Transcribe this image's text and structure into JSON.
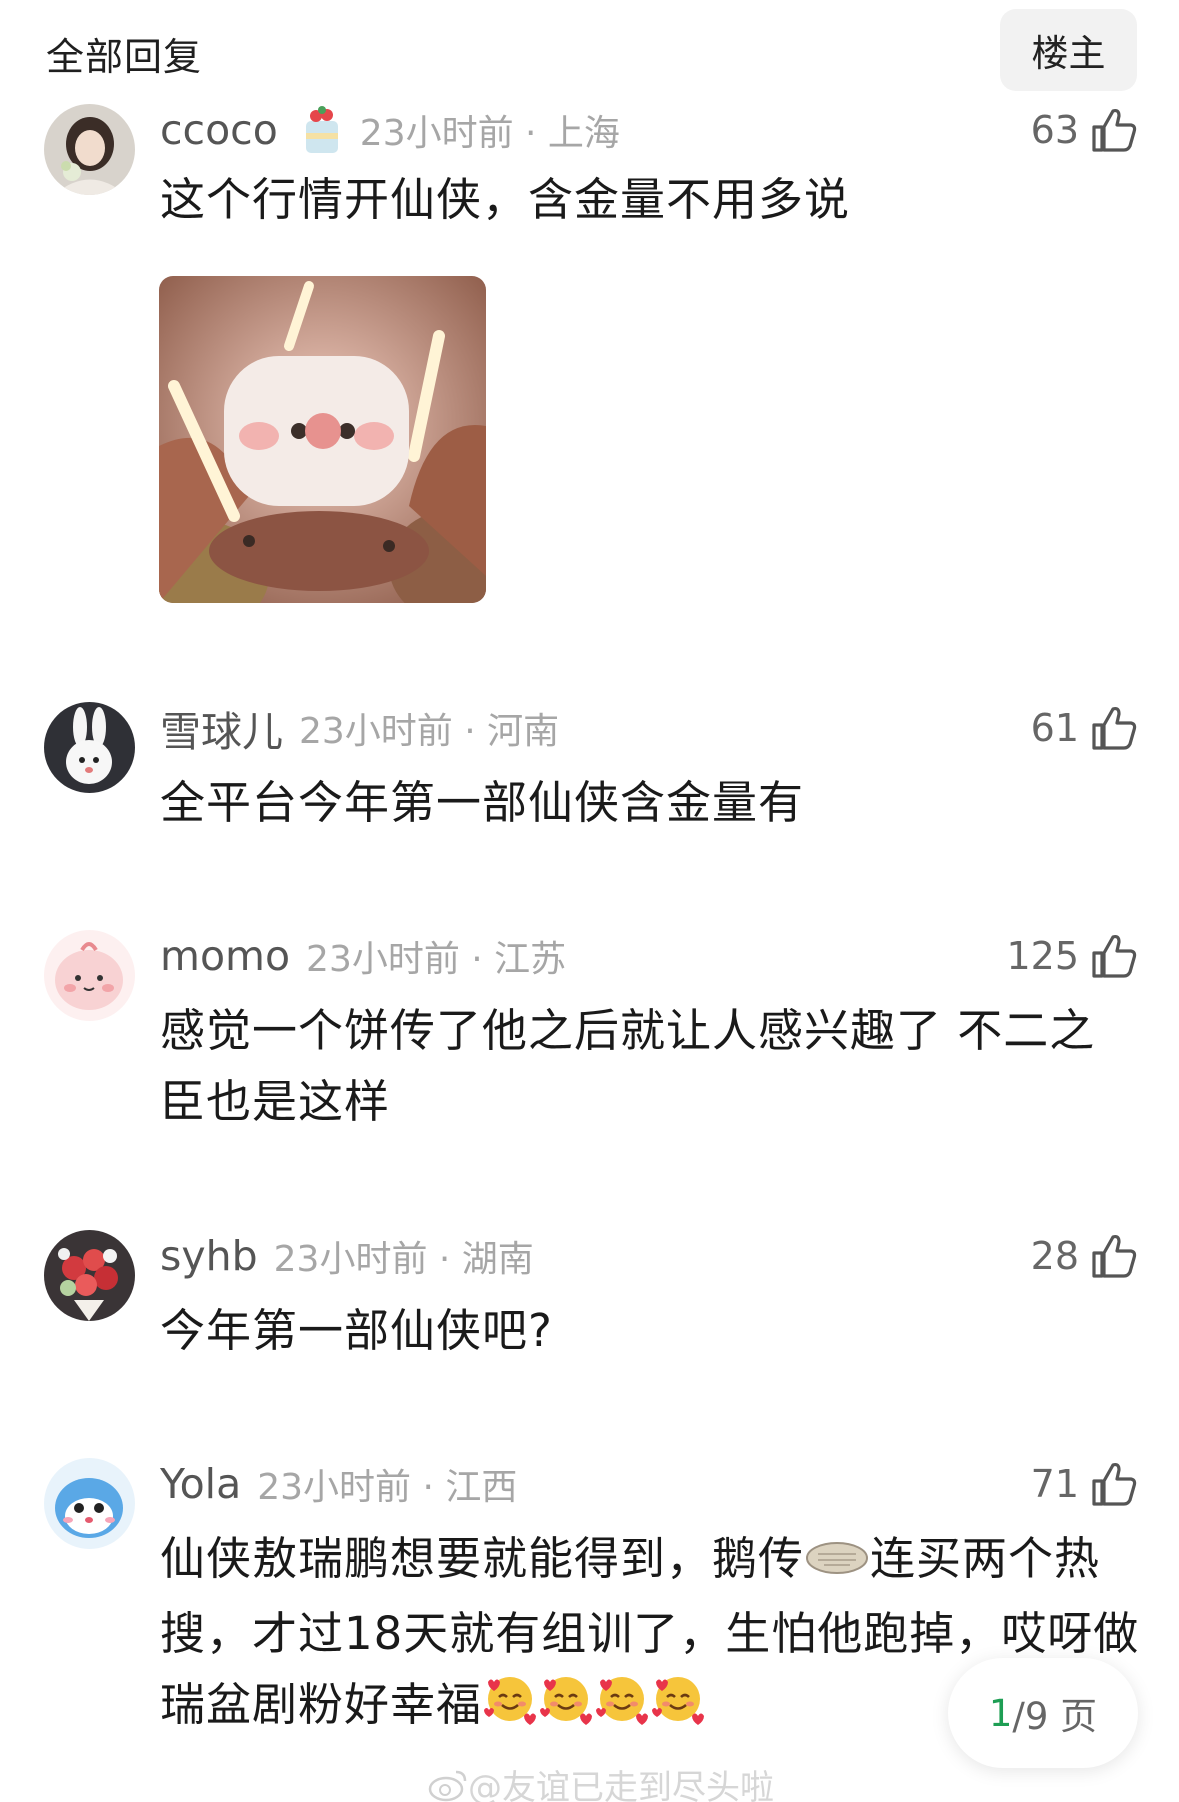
{
  "header": {
    "title": "全部回复",
    "filter_label": "楼主"
  },
  "comments": [
    {
      "username": "ccoco",
      "meta": "23小时前 · 上海",
      "likes": "63",
      "text": "这个行情开仙侠，含金量不用多说",
      "has_image": true,
      "avatar": "girl-avatar",
      "badge": "cake-badge-icon"
    },
    {
      "username": "雪球儿",
      "meta": "23小时前 · 河南",
      "likes": "61",
      "text": "全平台今年第一部仙侠含金量有",
      "avatar": "bunny-avatar"
    },
    {
      "username": "momo",
      "meta": "23小时前 · 江苏",
      "likes": "125",
      "text": "感觉一个饼传了他之后就让人感兴趣了 不二之臣也是这样",
      "avatar": "pink-creature-avatar"
    },
    {
      "username": "syhb",
      "meta": "23小时前 · 湖南",
      "likes": "28",
      "text": "今年第一部仙侠吧?",
      "avatar": "flower-bouquet-avatar"
    },
    {
      "username": "Yola",
      "meta": "23小时前 · 江西",
      "likes": "71",
      "text_part1": "仙侠敖瑞鹏想要就能得到，鹅传",
      "text_part2": "连买两个热搜，才过18天就有组训了，生怕他跑掉，哎呀做瑞盆剧粉好幸福",
      "avatar": "blue-cartoon-avatar",
      "inline_emojis": [
        "pancake-sticker-icon",
        "smiling-hearts-emoji",
        "smiling-hearts-emoji",
        "smiling-hearts-emoji",
        "smiling-hearts-emoji"
      ]
    }
  ],
  "pager": {
    "current": "1",
    "total": "/9 页"
  },
  "watermark": {
    "text": "@友谊已走到尽头啦"
  },
  "colors": {
    "username": "#555555",
    "meta": "#a6a6a6",
    "pager_current": "#1e9e54"
  }
}
